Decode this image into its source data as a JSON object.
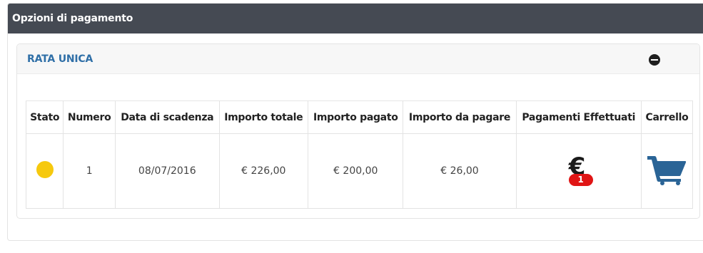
{
  "panel": {
    "title": "Opzioni di pagamento"
  },
  "rata": {
    "title": "RATA UNICA",
    "toggle_icon": "minus-circle-icon"
  },
  "table": {
    "headers": [
      "Stato",
      "Numero",
      "Data di scadenza",
      "Importo totale",
      "Importo pagato",
      "Importo da pagare",
      "Pagamenti Effettuati",
      "Carrello"
    ],
    "rows": [
      {
        "stato_color": "#f6c90e",
        "numero": "1",
        "data_scadenza": "08/07/2016",
        "importo_totale": "€ 226,00",
        "importo_pagato": "€ 200,00",
        "importo_da_pagare": "€ 26,00",
        "pagamenti_icon": "€",
        "pagamenti_count": "1",
        "carrello_icon": "cart-icon"
      }
    ]
  },
  "colors": {
    "header_bg": "#454a53",
    "accent": "#2f6fa7",
    "badge": "#e01515",
    "cart": "#2a6496"
  }
}
